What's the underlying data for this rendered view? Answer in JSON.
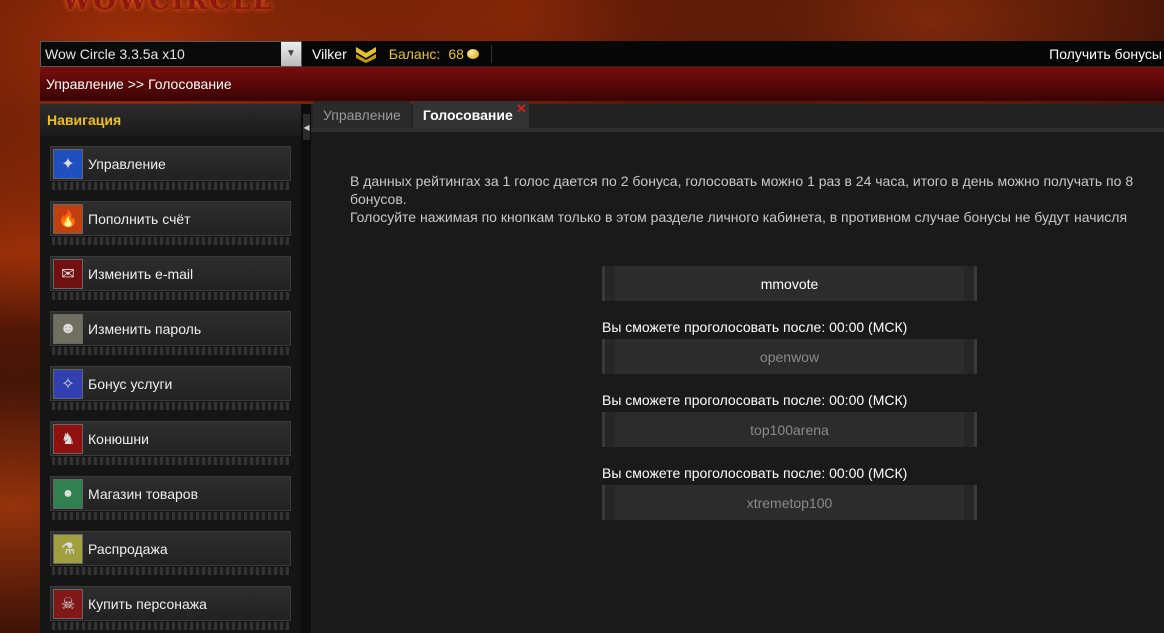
{
  "header": {
    "logo_text": "WOWCIRCLE",
    "realm_select": "Wow Circle 3.3.5a x10",
    "user_name": "Vilker",
    "balance_label": "Баланс:",
    "balance_value": "68",
    "get_bonus": "Получить бонусы"
  },
  "breadcrumb": {
    "root": "Управление >>",
    "current": "Голосование"
  },
  "sidebar": {
    "title": "Навигация",
    "items": [
      {
        "label": "Управление",
        "icon": "control-icon"
      },
      {
        "label": "Пополнить счёт",
        "icon": "fire-icon"
      },
      {
        "label": "Изменить e-mail",
        "icon": "mail-icon"
      },
      {
        "label": "Изменить пароль",
        "icon": "mask-icon"
      },
      {
        "label": "Бонус услуги",
        "icon": "bonus-icon"
      },
      {
        "label": "Конюшни",
        "icon": "mount-icon"
      },
      {
        "label": "Магазин товаров",
        "icon": "orb-icon"
      },
      {
        "label": "Распродажа",
        "icon": "potion-icon"
      },
      {
        "label": "Купить персонажа",
        "icon": "demon-icon"
      }
    ]
  },
  "tabs": [
    {
      "label": "Управление",
      "active": false
    },
    {
      "label": "Голосование",
      "active": true
    }
  ],
  "info": {
    "line1": "В данных рейтингах за 1 голос дается по 2 бонуса, голосовать можно 1 раз в 24 часа, итого в день можно получать по 8",
    "line2": "бонусов.",
    "line3": "Голосуйте нажимая по кнопкам только в этом разделе личного кабинета, в противном случае бонусы не будут начисля"
  },
  "votes": [
    {
      "label": "mmovote",
      "enabled": true,
      "note": ""
    },
    {
      "label": "openwow",
      "enabled": false,
      "note": "Вы сможете проголосовать после: 00:00 (МСК)"
    },
    {
      "label": "top100arena",
      "enabled": false,
      "note": "Вы сможете проголосовать после: 00:00 (МСК)"
    },
    {
      "label": "xtremetop100",
      "enabled": false,
      "note": "Вы сможете проголосовать после: 00:00 (МСК)"
    }
  ],
  "colors": {
    "accent": "#f0c018",
    "crumb_red": "#7a0c0c",
    "close": "#d02020"
  }
}
